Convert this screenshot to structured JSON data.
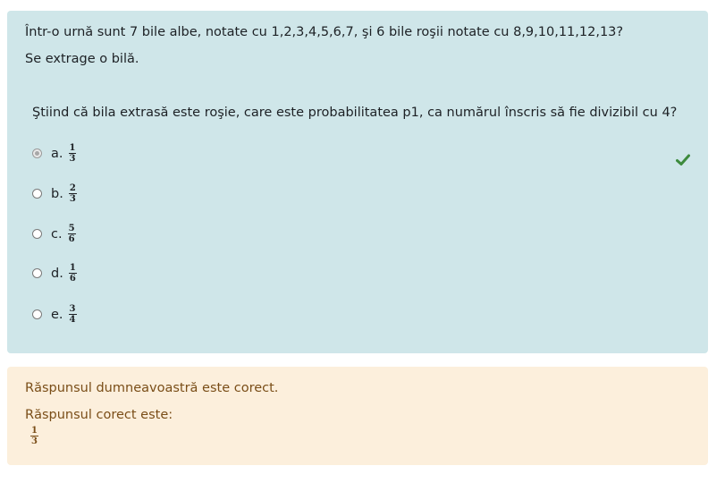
{
  "question": {
    "line1": "Într-o urnă sunt 7 bile albe, notate cu 1,2,3,4,5,6,7, şi 6 bile roşii notate cu 8,9,10,11,12,13?",
    "line2": "Se extrage o bilă.",
    "prompt": "Ştiind că bila extrasă este roşie, care este probabilitatea p1, ca numărul înscris să fie divizibil cu 4?",
    "answers": [
      {
        "letter": "a.",
        "num": "1",
        "den": "3",
        "selected": true,
        "correct": true
      },
      {
        "letter": "b.",
        "num": "2",
        "den": "3",
        "selected": false
      },
      {
        "letter": "c.",
        "num": "5",
        "den": "6",
        "selected": false
      },
      {
        "letter": "d.",
        "num": "1",
        "den": "6",
        "selected": false
      },
      {
        "letter": "e.",
        "num": "3",
        "den": "4",
        "selected": false
      }
    ],
    "correct_icon": "check-icon"
  },
  "feedback": {
    "status": "Răspunsul dumneavoastră este corect.",
    "correct_label": "Răspunsul corect este:",
    "correct_num": "1",
    "correct_den": "3"
  },
  "colors": {
    "question_bg": "#cfe6e9",
    "feedback_bg": "#fcefdc",
    "feedback_text": "#7a4e18",
    "check_green": "#3d8b3d"
  }
}
